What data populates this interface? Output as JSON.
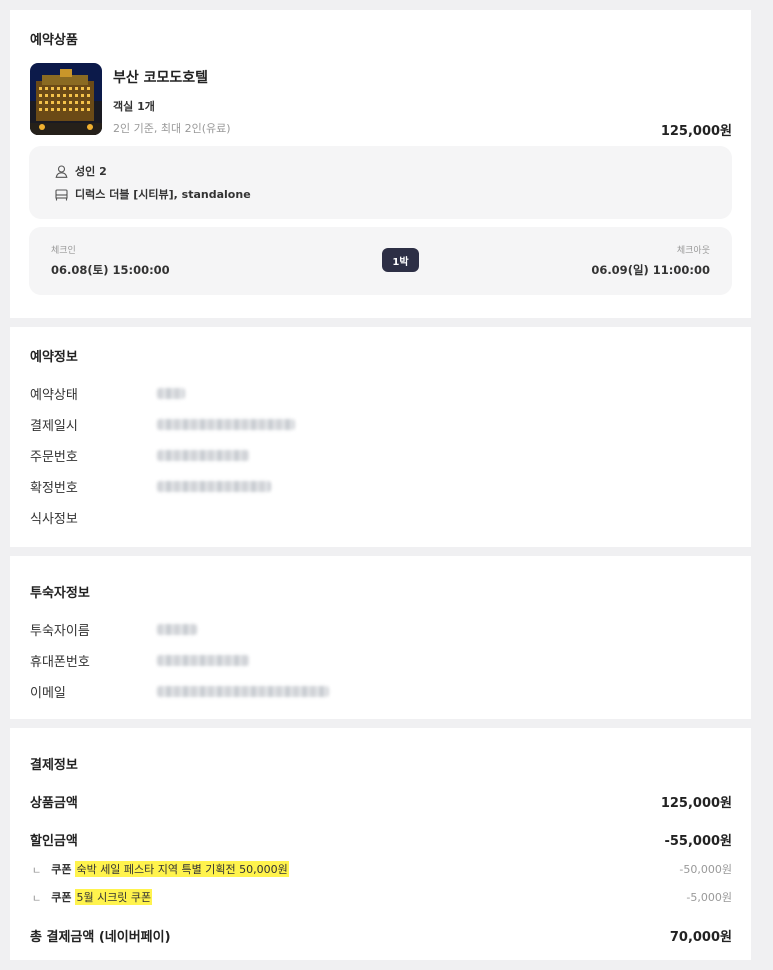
{
  "product_section": {
    "title": "예약상품",
    "name": "부산 코모도호텔",
    "room_count": "객실 1개",
    "capacity": "2인 기준, 최대 2인(유료)",
    "price": "125,000원",
    "guests": "성인 2",
    "room_type": "디럭스 더블 [시티뷰], standalone",
    "checkin_label": "체크인",
    "checkin_value": "06.08(토) 15:00:00",
    "nights": "1박",
    "checkout_label": "체크아웃",
    "checkout_value": "06.09(일) 11:00:00"
  },
  "reservation_section": {
    "title": "예약정보",
    "rows": [
      {
        "label": "예약상태"
      },
      {
        "label": "결제일시"
      },
      {
        "label": "주문번호"
      },
      {
        "label": "확정번호"
      },
      {
        "label": "식사정보"
      }
    ]
  },
  "guest_section": {
    "title": "투숙자정보",
    "rows": [
      {
        "label": "투숙자이름"
      },
      {
        "label": "휴대폰번호"
      },
      {
        "label": "이메일"
      }
    ]
  },
  "payment_section": {
    "title": "결제정보",
    "product_amount_label": "상품금액",
    "product_amount_value": "125,000원",
    "discount_label": "할인금액",
    "discount_value": "-55,000원",
    "coupons": [
      {
        "branch": "ㄴ",
        "type": "쿠폰",
        "name": "숙박 세일 페스타 지역 특별 기획전 50,000원",
        "amount": "-50,000원"
      },
      {
        "branch": "ㄴ",
        "type": "쿠폰",
        "name": "5월 시크릿 쿠폰",
        "amount": "-5,000원"
      }
    ],
    "total_label": "총 결제금액 (네이버페이)",
    "total_value": "70,000원"
  },
  "colors": {
    "background": "#f0f0f2",
    "card": "#ffffff",
    "info_box": "#f5f5f6",
    "nights_badge": "#2d2f45",
    "highlight": "#fff34d",
    "muted_text": "#999999"
  }
}
